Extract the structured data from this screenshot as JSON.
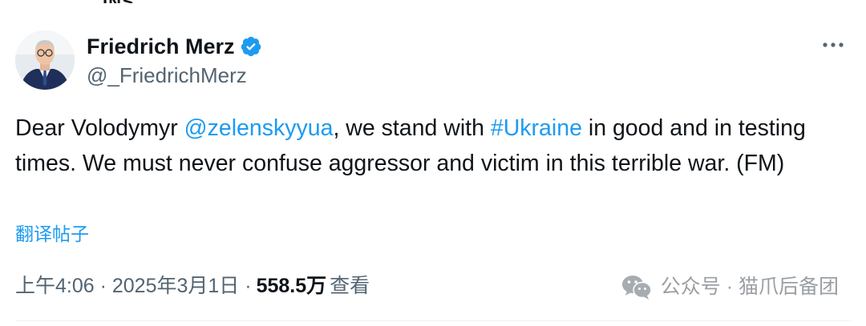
{
  "tweet": {
    "display_name": "Friedrich Merz",
    "handle": "@_FriedrichMerz",
    "text_segments": [
      {
        "text": "Dear Volodymyr ",
        "type": "text"
      },
      {
        "text": "@zelenskyyua",
        "type": "mention"
      },
      {
        "text": ", we stand with ",
        "type": "text"
      },
      {
        "text": "#Ukraine",
        "type": "hashtag"
      },
      {
        "text": " in good and in testing times. We must never confuse aggressor and victim in this terrible war. (FM)",
        "type": "text"
      }
    ],
    "translate_label": "翻译帖子",
    "timestamp": "上午4:06 · 2025年3月1日 · ",
    "views_count": "558.5万",
    "views_label": "查看"
  },
  "watermark": {
    "text": "公众号 · 猫爪后备团"
  },
  "colors": {
    "link": "#1d9bf0",
    "secondary_text": "#536471",
    "primary_text": "#0f1419",
    "verified_badge": "#1d9bf0"
  },
  "icons": {
    "verified": "verified-badge-icon",
    "more": "more-options-icon",
    "watermark": "wechat-icon"
  }
}
